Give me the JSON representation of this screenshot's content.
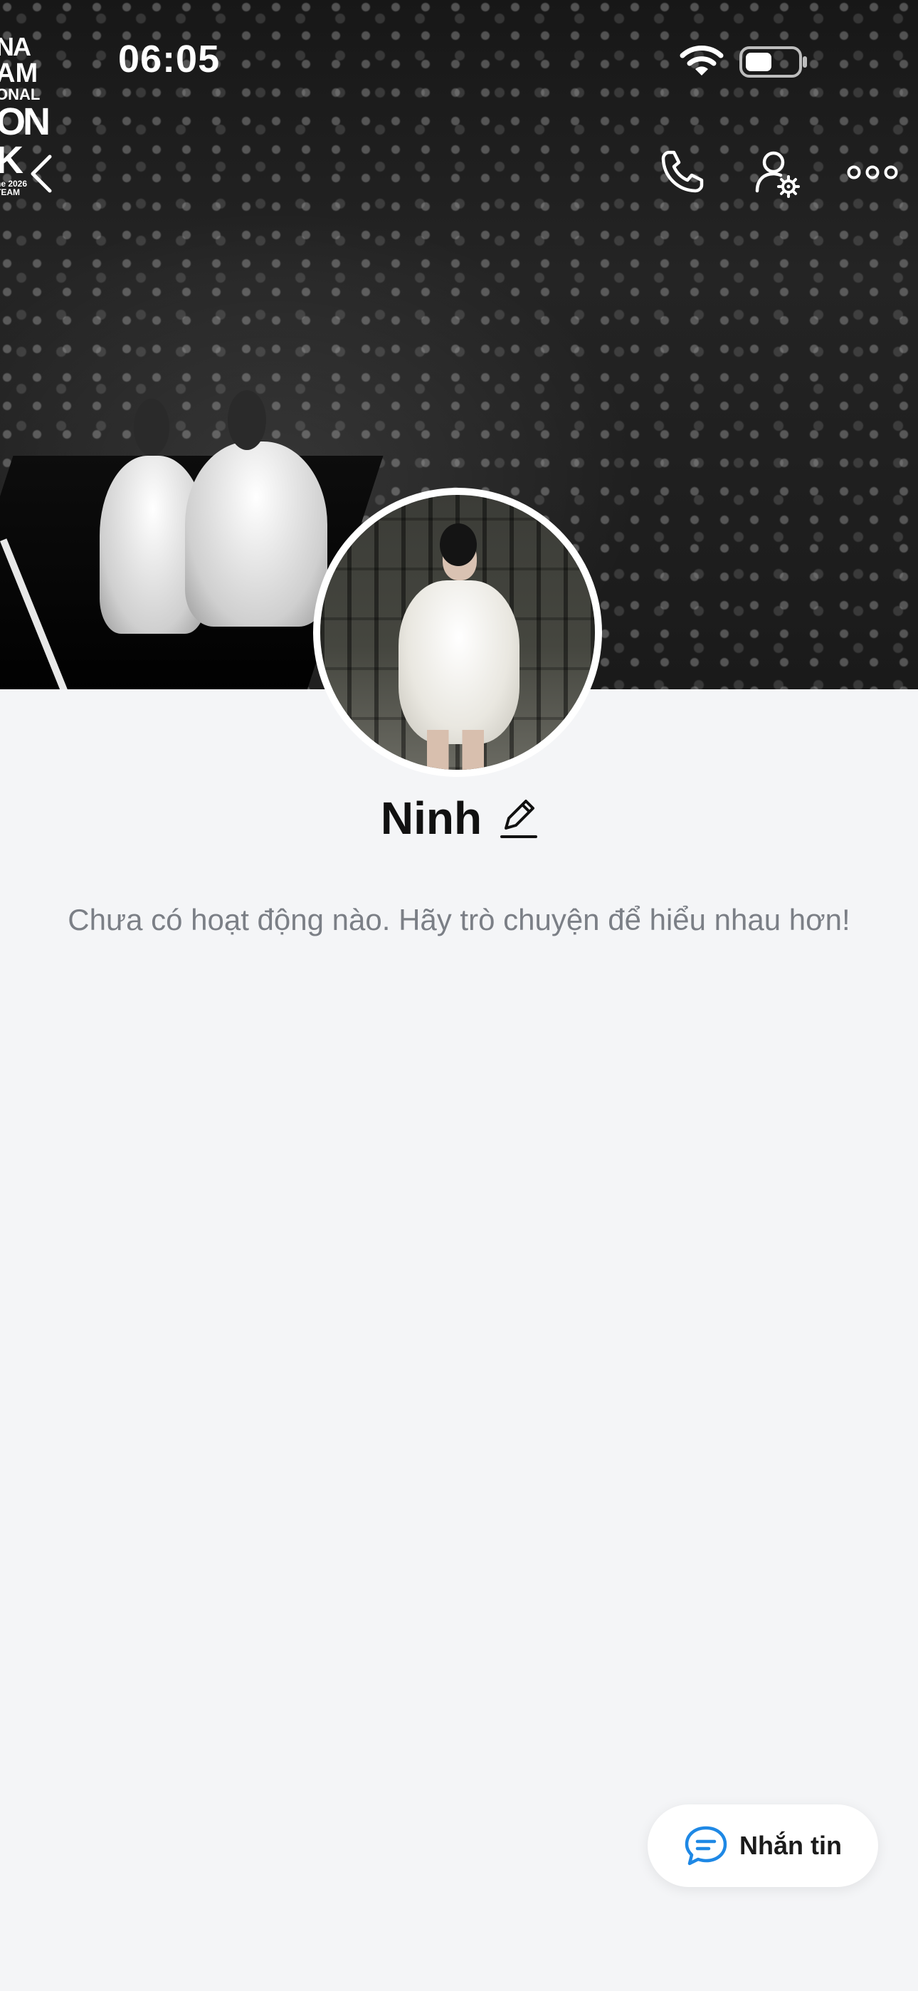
{
  "status_bar": {
    "time": "06:05"
  },
  "cover": {
    "poster_lines": [
      "NA",
      "AM",
      "ONAL",
      "ON",
      "K",
      "ne 2026",
      "TEAM"
    ]
  },
  "header": {
    "icons": [
      "back-icon",
      "phone-icon",
      "user-settings-icon",
      "more-icon"
    ]
  },
  "profile": {
    "name": "Ninh",
    "empty_activity_text": "Chưa có hoạt động nào. Hãy trò chuyện để hiểu nhau hơn!"
  },
  "fab": {
    "label": "Nhắn tin",
    "icon": "chat-bubble-icon",
    "icon_color": "#1e88e5"
  }
}
